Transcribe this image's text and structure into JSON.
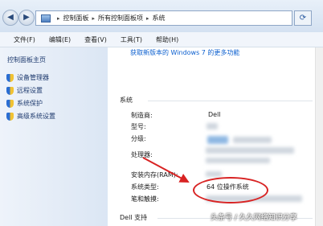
{
  "address": {
    "crumbs": [
      "控制面板",
      "所有控制面板项",
      "系统"
    ],
    "back_icon": "back-arrow-icon",
    "forward_icon": "forward-arrow-icon",
    "refresh_icon": "refresh-icon"
  },
  "menu": [
    "文件(F)",
    "编辑(E)",
    "查看(V)",
    "工具(T)",
    "帮助(H)"
  ],
  "sidebar": {
    "home": "控制面板主页",
    "items": [
      "设备管理器",
      "远程设置",
      "系统保护",
      "高级系统设置"
    ]
  },
  "content": {
    "top_link": "获取新版本的 Windows 7 的更多功能",
    "system_section": "系统",
    "rows": {
      "manufacturer_label": "制造商:",
      "manufacturer_value": "Dell",
      "model_label": "型号:",
      "rating_label": "分级:",
      "processor_label": "处理器:",
      "ram_label": "安装内存(RAM):",
      "systype_label": "系统类型:",
      "systype_value": "64 位操作系统",
      "pen_label": "笔和触摸:"
    },
    "support_section": "Dell 支持"
  },
  "watermark": "头条号 / 久久网络知识分享",
  "colors": {
    "annotation": "#d82323",
    "link": "#0b5fcf"
  }
}
